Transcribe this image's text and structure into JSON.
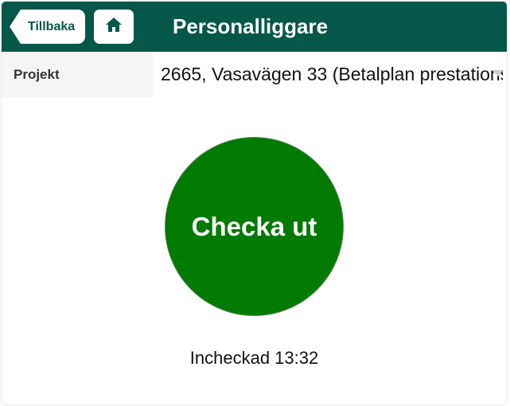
{
  "header": {
    "back_label": "Tillbaka",
    "title": "Personalliggare",
    "home_icon": "home-icon"
  },
  "project": {
    "label": "Projekt",
    "selected_value": "2665, Vasavägen 33 (Betalplan prestations"
  },
  "action": {
    "checkout_label": "Checka ut"
  },
  "status": {
    "checked_in_text": "Incheckad 13:32"
  },
  "colors": {
    "header_bg": "#05574a",
    "button_green": "#007a00",
    "label_bg": "#f5f5f5"
  }
}
